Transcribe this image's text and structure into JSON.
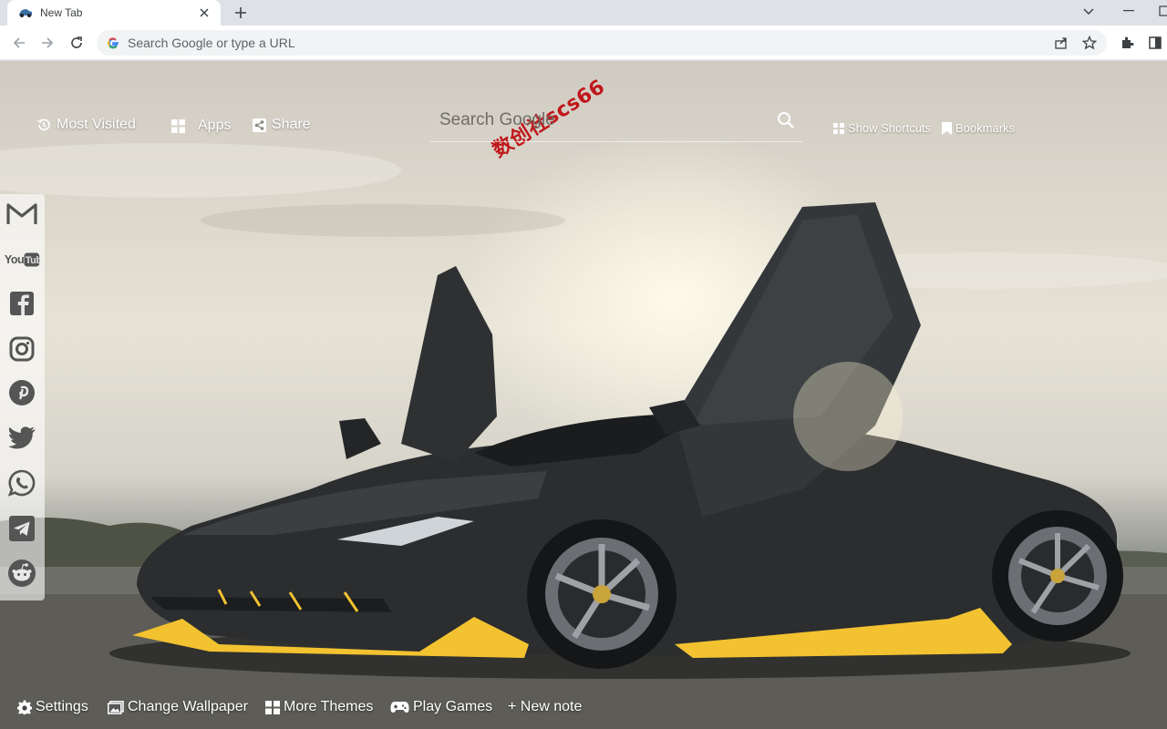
{
  "browser": {
    "tab": {
      "title": "New Tab",
      "favicon": "car-favicon",
      "close_icon": "close-icon"
    },
    "new_tab_icon": "plus-icon",
    "omnibox": {
      "placeholder": "Search Google or type a URL"
    },
    "toolbar_icons": [
      "back-icon",
      "forward-icon",
      "reload-icon",
      "share-icon",
      "star-icon",
      "extensions-icon",
      "sidepanel-icon"
    ]
  },
  "newtab": {
    "watermark": "数创社scs66",
    "top_links": {
      "most_visited": "Most Visited",
      "apps": "Apps",
      "share": "Share",
      "show_shortcuts": "Show Shortcuts",
      "bookmarks": "Bookmarks"
    },
    "search": {
      "placeholder": "Search Google"
    },
    "social": [
      "gmail-icon",
      "youtube-icon",
      "facebook-icon",
      "instagram-icon",
      "pinterest-icon",
      "twitter-icon",
      "whatsapp-icon",
      "telegram-icon",
      "reddit-icon"
    ],
    "social_youtube_text": "YouTube",
    "bottom": {
      "settings": "Settings",
      "change_wallpaper": "Change Wallpaper",
      "more_themes": "More Themes",
      "play_games": "Play Games",
      "new_note": "+ New note"
    }
  },
  "colors": {
    "accent_yellow": "#f2c230",
    "car_body": "#2b2d2f",
    "watermark": "#c0161a"
  }
}
